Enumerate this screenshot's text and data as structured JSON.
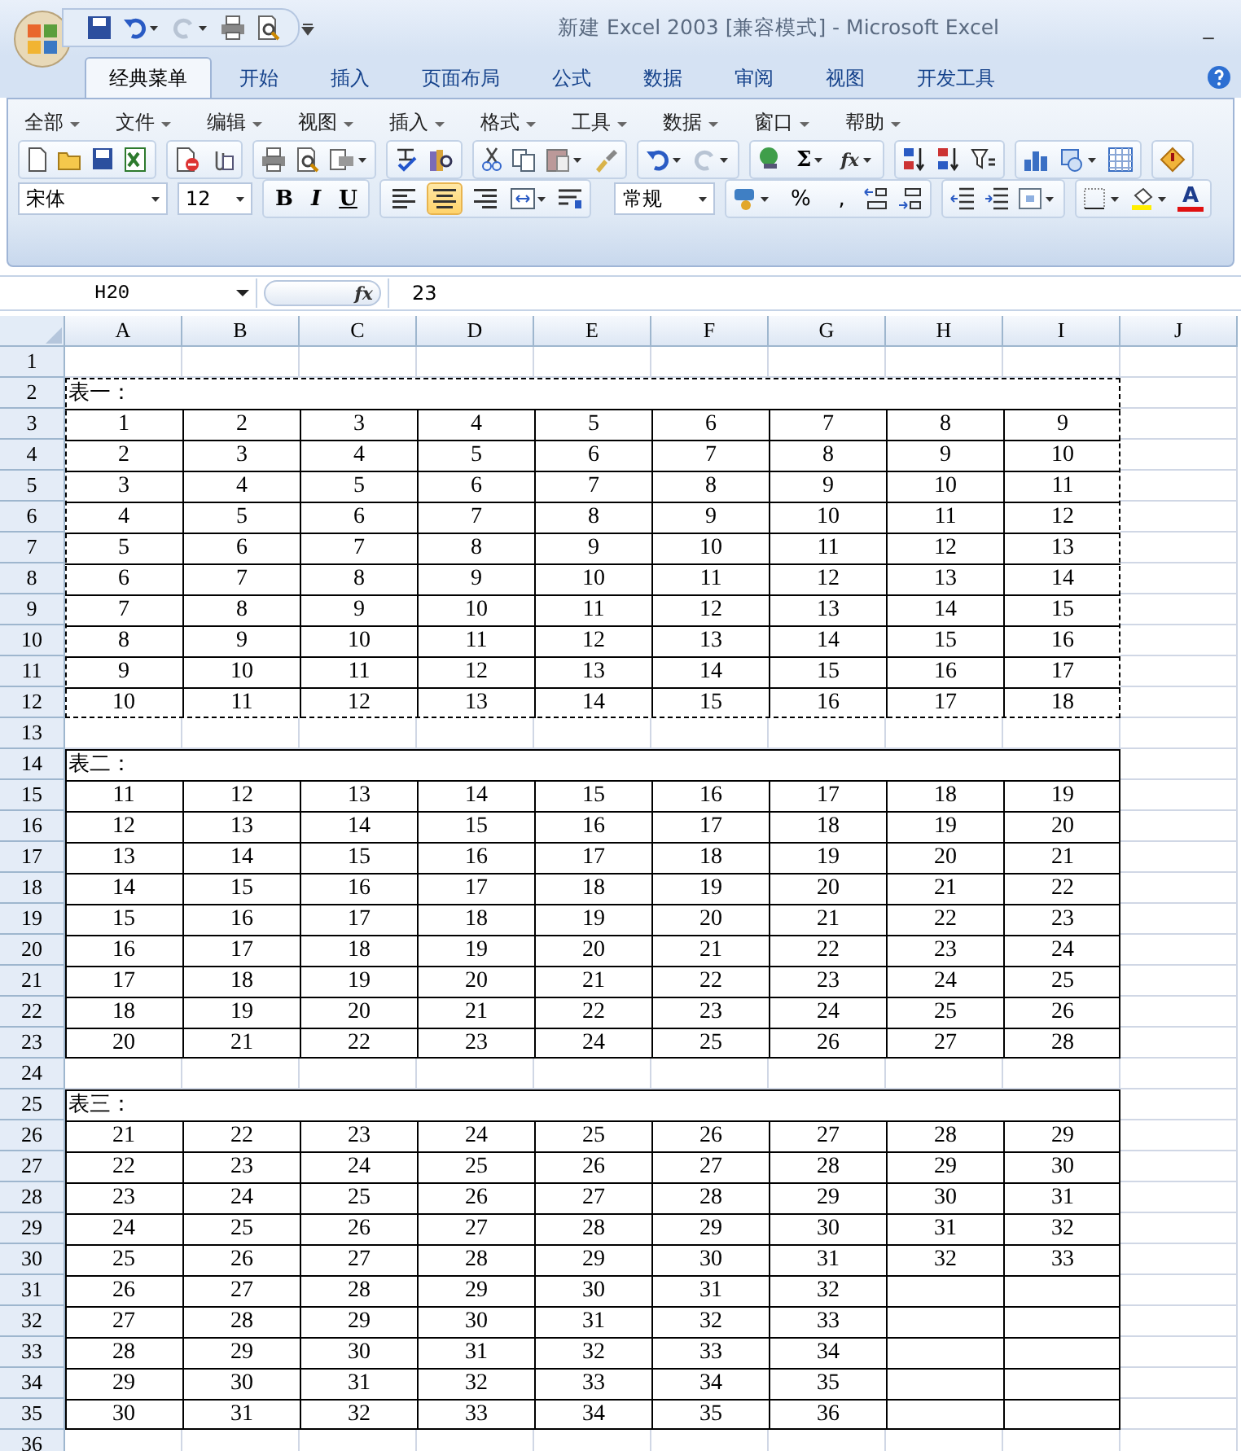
{
  "window": {
    "title": "新建 Excel 2003  [兼容模式] - Microsoft Excel",
    "minimize": "_"
  },
  "tabs": [
    {
      "label": "经典菜单",
      "selected": true
    },
    {
      "label": "开始",
      "selected": false
    },
    {
      "label": "插入",
      "selected": false
    },
    {
      "label": "页面布局",
      "selected": false
    },
    {
      "label": "公式",
      "selected": false
    },
    {
      "label": "数据",
      "selected": false
    },
    {
      "label": "审阅",
      "selected": false
    },
    {
      "label": "视图",
      "selected": false
    },
    {
      "label": "开发工具",
      "selected": false
    }
  ],
  "menus": [
    "全部",
    "文件",
    "编辑",
    "视图",
    "插入",
    "格式",
    "工具",
    "数据",
    "窗口",
    "帮助"
  ],
  "formula_tools": {
    "sum": "Σ",
    "function": "fx"
  },
  "font": {
    "name": "宋体",
    "size": "12"
  },
  "text_style": [
    "B",
    "I",
    "U"
  ],
  "alignment": [
    {
      "kind": "left",
      "selected": false
    },
    {
      "kind": "center",
      "selected": true
    },
    {
      "kind": "right",
      "selected": false
    }
  ],
  "number_format": "常规",
  "number_buttons": [
    "%",
    ","
  ],
  "font_color": "A",
  "formula_bar": {
    "name_box": "H20",
    "fx": "fx",
    "value": "23"
  },
  "sheet": {
    "columns": [
      "A",
      "B",
      "C",
      "D",
      "E",
      "F",
      "G",
      "H",
      "I",
      "J"
    ],
    "blocks": [
      {
        "kind": "blank",
        "rows": [
          "1"
        ]
      },
      {
        "kind": "table",
        "dashed_border": true,
        "title_row": "2",
        "title": "表一：",
        "rows": [
          {
            "n": "3",
            "cells": [
              "1",
              "2",
              "3",
              "4",
              "5",
              "6",
              "7",
              "8",
              "9"
            ]
          },
          {
            "n": "4",
            "cells": [
              "2",
              "3",
              "4",
              "5",
              "6",
              "7",
              "8",
              "9",
              "10"
            ]
          },
          {
            "n": "5",
            "cells": [
              "3",
              "4",
              "5",
              "6",
              "7",
              "8",
              "9",
              "10",
              "11"
            ]
          },
          {
            "n": "6",
            "cells": [
              "4",
              "5",
              "6",
              "7",
              "8",
              "9",
              "10",
              "11",
              "12"
            ]
          },
          {
            "n": "7",
            "cells": [
              "5",
              "6",
              "7",
              "8",
              "9",
              "10",
              "11",
              "12",
              "13"
            ]
          },
          {
            "n": "8",
            "cells": [
              "6",
              "7",
              "8",
              "9",
              "10",
              "11",
              "12",
              "13",
              "14"
            ]
          },
          {
            "n": "9",
            "cells": [
              "7",
              "8",
              "9",
              "10",
              "11",
              "12",
              "13",
              "14",
              "15"
            ]
          },
          {
            "n": "10",
            "cells": [
              "8",
              "9",
              "10",
              "11",
              "12",
              "13",
              "14",
              "15",
              "16"
            ]
          },
          {
            "n": "11",
            "cells": [
              "9",
              "10",
              "11",
              "12",
              "13",
              "14",
              "15",
              "16",
              "17"
            ]
          },
          {
            "n": "12",
            "cells": [
              "10",
              "11",
              "12",
              "13",
              "14",
              "15",
              "16",
              "17",
              "18"
            ]
          }
        ]
      },
      {
        "kind": "blank",
        "rows": [
          "13"
        ]
      },
      {
        "kind": "table",
        "dashed_border": false,
        "title_row": "14",
        "title": "表二：",
        "rows": [
          {
            "n": "15",
            "cells": [
              "11",
              "12",
              "13",
              "14",
              "15",
              "16",
              "17",
              "18",
              "19"
            ]
          },
          {
            "n": "16",
            "cells": [
              "12",
              "13",
              "14",
              "15",
              "16",
              "17",
              "18",
              "19",
              "20"
            ]
          },
          {
            "n": "17",
            "cells": [
              "13",
              "14",
              "15",
              "16",
              "17",
              "18",
              "19",
              "20",
              "21"
            ]
          },
          {
            "n": "18",
            "cells": [
              "14",
              "15",
              "16",
              "17",
              "18",
              "19",
              "20",
              "21",
              "22"
            ]
          },
          {
            "n": "19",
            "cells": [
              "15",
              "16",
              "17",
              "18",
              "19",
              "20",
              "21",
              "22",
              "23"
            ]
          },
          {
            "n": "20",
            "cells": [
              "16",
              "17",
              "18",
              "19",
              "20",
              "21",
              "22",
              "23",
              "24"
            ]
          },
          {
            "n": "21",
            "cells": [
              "17",
              "18",
              "19",
              "20",
              "21",
              "22",
              "23",
              "24",
              "25"
            ]
          },
          {
            "n": "22",
            "cells": [
              "18",
              "19",
              "20",
              "21",
              "22",
              "23",
              "24",
              "25",
              "26"
            ]
          },
          {
            "n": "23",
            "cells": [
              "20",
              "21",
              "22",
              "23",
              "24",
              "25",
              "26",
              "27",
              "28"
            ]
          }
        ]
      },
      {
        "kind": "blank",
        "rows": [
          "24"
        ]
      },
      {
        "kind": "table",
        "dashed_border": false,
        "title_row": "25",
        "title": "表三：",
        "rows": [
          {
            "n": "26",
            "cells": [
              "21",
              "22",
              "23",
              "24",
              "25",
              "26",
              "27",
              "28",
              "29"
            ]
          },
          {
            "n": "27",
            "cells": [
              "22",
              "23",
              "24",
              "25",
              "26",
              "27",
              "28",
              "29",
              "30"
            ]
          },
          {
            "n": "28",
            "cells": [
              "23",
              "24",
              "25",
              "26",
              "27",
              "28",
              "29",
              "30",
              "31"
            ]
          },
          {
            "n": "29",
            "cells": [
              "24",
              "25",
              "26",
              "27",
              "28",
              "29",
              "30",
              "31",
              "32"
            ]
          },
          {
            "n": "30",
            "cells": [
              "25",
              "26",
              "27",
              "28",
              "29",
              "30",
              "31",
              "32",
              "33"
            ]
          },
          {
            "n": "31",
            "cells": [
              "26",
              "27",
              "28",
              "29",
              "30",
              "31",
              "32"
            ]
          },
          {
            "n": "32",
            "cells": [
              "27",
              "28",
              "29",
              "30",
              "31",
              "32",
              "33"
            ]
          },
          {
            "n": "33",
            "cells": [
              "28",
              "29",
              "30",
              "31",
              "32",
              "33",
              "34"
            ]
          },
          {
            "n": "34",
            "cells": [
              "29",
              "30",
              "31",
              "32",
              "33",
              "34",
              "35"
            ]
          },
          {
            "n": "35",
            "cells": [
              "30",
              "31",
              "32",
              "33",
              "34",
              "35",
              "36"
            ]
          }
        ]
      },
      {
        "kind": "blank",
        "rows": [
          "36"
        ]
      }
    ]
  }
}
